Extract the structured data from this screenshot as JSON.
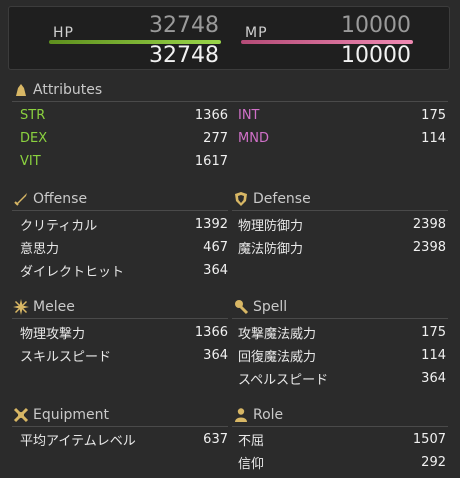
{
  "hp": {
    "label": "HP",
    "current": "32748",
    "max": "32748",
    "color": "#8ac43c"
  },
  "mp": {
    "label": "MP",
    "current": "10000",
    "max": "10000",
    "color": "#e77aa4"
  },
  "attributes": {
    "title": "Attributes",
    "left": [
      {
        "label": "STR",
        "value": "1366",
        "color": "#8bd23f"
      },
      {
        "label": "DEX",
        "value": "277",
        "color": "#8bd23f"
      },
      {
        "label": "VIT",
        "value": "1617",
        "color": "#8bd23f"
      }
    ],
    "right": [
      {
        "label": "INT",
        "value": "175",
        "color": "#d070c8"
      },
      {
        "label": "MND",
        "value": "114",
        "color": "#d070c8"
      }
    ]
  },
  "offense": {
    "title": "Offense",
    "rows": [
      {
        "label": "クリティカル",
        "value": "1392"
      },
      {
        "label": "意思力",
        "value": "467"
      },
      {
        "label": "ダイレクトヒット",
        "value": "364"
      }
    ]
  },
  "defense": {
    "title": "Defense",
    "rows": [
      {
        "label": "物理防御力",
        "value": "2398"
      },
      {
        "label": "魔法防御力",
        "value": "2398"
      }
    ]
  },
  "melee": {
    "title": "Melee",
    "rows": [
      {
        "label": "物理攻撃力",
        "value": "1366"
      },
      {
        "label": "スキルスピード",
        "value": "364"
      }
    ]
  },
  "spell": {
    "title": "Spell",
    "rows": [
      {
        "label": "攻撃魔法威力",
        "value": "175"
      },
      {
        "label": "回復魔法威力",
        "value": "114"
      },
      {
        "label": "スペルスピード",
        "value": "364"
      }
    ]
  },
  "equipment": {
    "title": "Equipment",
    "rows": [
      {
        "label": "平均アイテムレベル",
        "value": "637"
      }
    ]
  },
  "role": {
    "title": "Role",
    "rows": [
      {
        "label": "不屈",
        "value": "1507"
      },
      {
        "label": "信仰",
        "value": "292"
      }
    ]
  }
}
